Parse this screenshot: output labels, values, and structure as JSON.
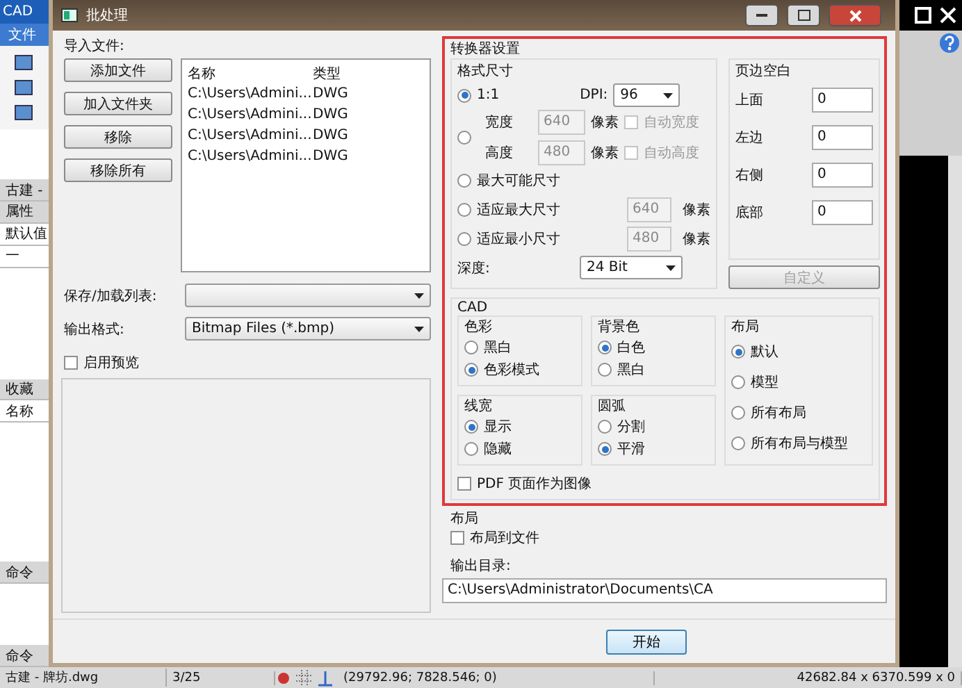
{
  "app": {
    "logo": "CAD",
    "menu": "文件",
    "side_labels": [
      {
        "kind": "tab",
        "text": "古建 -"
      },
      {
        "kind": "tab",
        "text": "属性"
      },
      {
        "kind": "row",
        "text": "默认值"
      },
      {
        "kind": "tree",
        "text": "一"
      },
      {
        "kind": "tab",
        "text": "收藏"
      },
      {
        "kind": "row",
        "text": "名称"
      },
      {
        "kind": "tab",
        "text": "命令"
      },
      {
        "kind": "tab",
        "text": "命令"
      }
    ],
    "status_bar": {
      "file": "古建 - 牌坊.dwg",
      "page": "3/25",
      "coords": "(29792.96; 7828.546; 0)",
      "size": "42682.84 x 6370.599 x 0"
    }
  },
  "dialog": {
    "title": "批处理",
    "import": {
      "label": "导入文件:",
      "buttons": [
        "添加文件",
        "加入文件夹",
        "移除",
        "移除所有"
      ],
      "columns": [
        "名称",
        "类型"
      ],
      "rows": [
        [
          "C:\\Users\\Admini...",
          "DWG"
        ],
        [
          "C:\\Users\\Admini...",
          "DWG"
        ],
        [
          "C:\\Users\\Admini...",
          "DWG"
        ],
        [
          "C:\\Users\\Admini...",
          "DWG"
        ]
      ]
    },
    "save_list": {
      "label": "保存/加载列表:"
    },
    "output_format": {
      "label": "输出格式:",
      "value": "Bitmap Files (*.bmp)"
    },
    "preview": {
      "label": "启用预览",
      "checked": false
    },
    "converter": {
      "title": "转换器设置",
      "size": {
        "title": "格式尺寸",
        "options": [
          {
            "kind": "ratio",
            "label": "1:1",
            "selected": true,
            "dpi_label": "DPI:",
            "dpi": "96"
          },
          {
            "kind": "custom",
            "selected": false,
            "rows": [
              {
                "label": "宽度",
                "value": "640",
                "unit": "像素",
                "auto": "自动宽度",
                "checked": false,
                "disabled": true
              },
              {
                "label": "高度",
                "value": "480",
                "unit": "像素",
                "auto": "自动高度",
                "checked": false,
                "disabled": true
              }
            ]
          },
          {
            "kind": "plain",
            "label": "最大可能尺寸",
            "selected": false
          },
          {
            "kind": "fit",
            "label": "适应最大尺寸",
            "selected": false,
            "value": "640",
            "unit": "像素",
            "disabled": true
          },
          {
            "kind": "fit",
            "label": "适应最小尺寸",
            "selected": false,
            "value": "480",
            "unit": "像素",
            "disabled": true
          }
        ],
        "depth_label": "深度:",
        "depth": "24 Bit"
      },
      "margins": {
        "title": "页边空白",
        "items": [
          {
            "label": "上面",
            "value": "0"
          },
          {
            "label": "左边",
            "value": "0"
          },
          {
            "label": "右侧",
            "value": "0"
          },
          {
            "label": "底部",
            "value": "0"
          }
        ]
      },
      "custom_button": {
        "label": "自定义",
        "disabled": true
      },
      "cad": {
        "title": "CAD",
        "groups": [
          {
            "title": "色彩",
            "options": [
              {
                "label": "黑白",
                "selected": false
              },
              {
                "label": "色彩模式",
                "selected": true
              }
            ]
          },
          {
            "title": "背景色",
            "options": [
              {
                "label": "白色",
                "selected": true
              },
              {
                "label": "黑白",
                "selected": false
              }
            ]
          },
          {
            "title": "线宽",
            "options": [
              {
                "label": "显示",
                "selected": true
              },
              {
                "label": "隐藏",
                "selected": false
              }
            ]
          },
          {
            "title": "圆弧",
            "options": [
              {
                "label": "分割",
                "selected": false
              },
              {
                "label": "平滑",
                "selected": true
              }
            ]
          }
        ],
        "layout": {
          "title": "布局",
          "options": [
            {
              "label": "默认",
              "selected": true
            },
            {
              "label": "模型",
              "selected": false
            },
            {
              "label": "所有布局",
              "selected": false
            },
            {
              "label": "所有布局与模型",
              "selected": false
            }
          ]
        },
        "pdf": {
          "label": "PDF 页面作为图像",
          "checked": false
        }
      }
    },
    "layout": {
      "title": "布局",
      "checkbox": {
        "label": "布局到文件",
        "checked": false
      }
    },
    "output_dir": {
      "label": "输出目录:",
      "value": "C:\\Users\\Administrator\\Documents\\CA"
    },
    "start_button": "开始"
  }
}
